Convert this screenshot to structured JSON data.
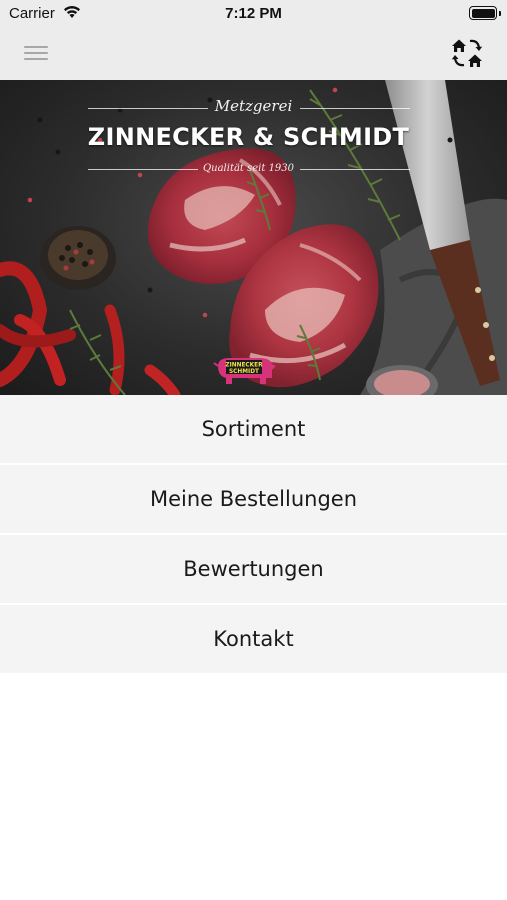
{
  "status_bar": {
    "carrier": "Carrier",
    "time": "7:12 PM"
  },
  "nav": {
    "menu_icon": "hamburger-menu-icon",
    "switch_icon": "house-switch-icon"
  },
  "hero": {
    "brand_prefix": "Metzgerei",
    "brand_name": "ZINNECKER & SCHMIDT",
    "brand_tagline": "Qualität seit 1930",
    "badge_lines": [
      "ZINNECKER",
      "SCHMIDT"
    ]
  },
  "menu": {
    "items": [
      {
        "label": "Sortiment"
      },
      {
        "label": "Meine Bestellungen"
      },
      {
        "label": "Bewertungen"
      },
      {
        "label": "Kontakt"
      }
    ]
  },
  "colors": {
    "bar_background": "#ececec",
    "menu_background": "#f4f4f4",
    "badge_pink": "#d6337a"
  }
}
